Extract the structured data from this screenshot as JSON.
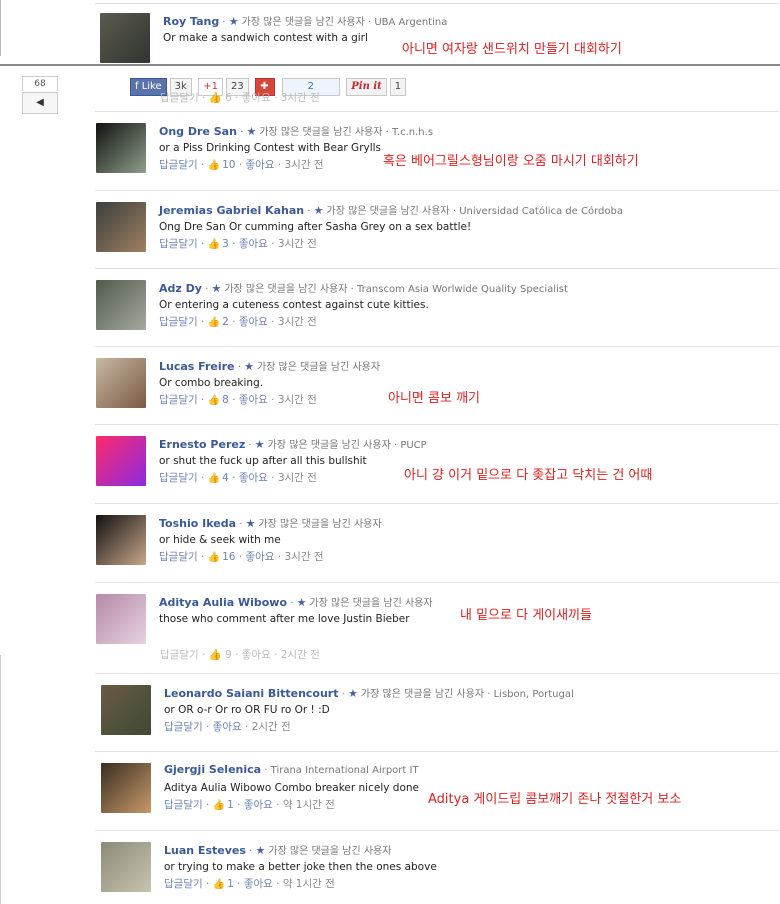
{
  "ui": {
    "like_glyph": "👍",
    "dot": " · ",
    "star": "★"
  },
  "share_bar": {
    "fb_like_label": "Like",
    "fb_like_count": "3k",
    "gplus_label": "+1",
    "gplus_count": "23",
    "counter_2": "2",
    "pin_label": "Pin it",
    "pin_count": "1",
    "side_count": "68",
    "side_back": "◀"
  },
  "comments_top": [
    {
      "name": "Roy Tang",
      "badge": "가장 많은 댓글을 남긴 사용자",
      "affiliation": "UBA Argentina",
      "text": "Or make a sandwich contest with a girl",
      "note": "아니면 여자랑 샌드위치 만들기 대회하기",
      "avatar_colors": [
        "#5d5a4e",
        "#2e3530"
      ]
    }
  ],
  "comments_mid": [
    {
      "name": "Ong Dre San",
      "badge": "가장 많은 댓글을 남긴 사용자",
      "affiliation": "T.c.n.h.s",
      "text": "or a Piss Drinking Contest with Bear Grylls",
      "reply": "답글달기",
      "likes": "10",
      "like_label": "좋아요",
      "time": "3시간 전",
      "note": "혹은 베어그릴스형님이랑 오줌 마시기 대회하기",
      "avatar_colors": [
        "#111111",
        "#8fa08a"
      ]
    },
    {
      "name": "Jeremias Gabriel Kahan",
      "badge": "가장 많은 댓글을 남긴 사용자",
      "affiliation": "Universidad Católica de Córdoba",
      "text": "Ong Dre San Or cumming after Sasha Grey on a sex battle!",
      "reply": "답글달기",
      "likes": "3",
      "like_label": "좋아요",
      "time": "3시간 전",
      "note": "",
      "avatar_colors": [
        "#3a3f3c",
        "#a08062"
      ]
    },
    {
      "name": "Adz Dy",
      "badge": "가장 많은 댓글을 남긴 사용자",
      "affiliation": "Transcom Asia Worlwide Quality Specialist",
      "text": "Or entering a cuteness contest against cute kitties.",
      "reply": "답글달기",
      "likes": "2",
      "like_label": "좋아요",
      "time": "3시간 전",
      "note": "",
      "avatar_colors": [
        "#505a48",
        "#a5a9a0"
      ]
    },
    {
      "name": "Lucas Freire",
      "badge": "가장 많은 댓글을 남긴 사용자",
      "affiliation": "",
      "text": "Or combo breaking.",
      "reply": "답글달기",
      "likes": "8",
      "like_label": "좋아요",
      "time": "3시간 전",
      "note": "아니면 콤보 깨기",
      "avatar_colors": [
        "#c8b8a2",
        "#7a5a45"
      ]
    },
    {
      "name": "Ernesto Perez",
      "badge": "가장 많은 댓글을 남긴 사용자",
      "affiliation": "PUCP",
      "text": "or shut the fuck up after all this bullshit",
      "reply": "답글달기",
      "likes": "4",
      "like_label": "좋아요",
      "time": "3시간 전",
      "note": "아니 걍 이거 밑으로 다 좆잡고 닥치는 건 어때",
      "avatar_colors": [
        "#ff2a6a",
        "#8a2be2"
      ]
    },
    {
      "name": "Toshio Ikeda",
      "badge": "가장 많은 댓글을 남긴 사용자",
      "affiliation": "",
      "text": "or hide & seek with me",
      "reply": "답글달기",
      "likes": "16",
      "like_label": "좋아요",
      "time": "3시간 전",
      "note": "",
      "avatar_colors": [
        "#121212",
        "#c9a68a"
      ]
    },
    {
      "name": "Aditya Aulia Wibowo",
      "badge": "가장 많은 댓글을 남긴 사용자",
      "affiliation": "",
      "text": "those who comment after me love Justin Bieber",
      "reply": "",
      "likes": "",
      "like_label": "",
      "time": "",
      "note": "내 밑으로 다 게이새끼들",
      "avatar_colors": [
        "#b68aa8",
        "#e6d2de"
      ]
    }
  ],
  "comments_bot": [
    {
      "name": "Leonardo Saiani Bittencourt",
      "badge": "가장 많은 댓글을 남긴 사용자",
      "affiliation": "Lisbon, Portugal",
      "text": "or OR o-r Or ro OR FU ro Or ! :D",
      "reply": "답글달기",
      "likes": "",
      "like_label": "좋아요",
      "time": "2시간 전",
      "note": "",
      "avatar_colors": [
        "#6b5a44",
        "#3d4a34"
      ]
    },
    {
      "name": "Gjergji Selenica",
      "badge": "",
      "affiliation": "Tirana International Airport IT",
      "text": "Aditya Aulia Wibowo Combo breaker nicely done",
      "reply": "답글달기",
      "likes": "1",
      "like_label": "좋아요",
      "time": "약 1시간 전",
      "note": "Aditya 게이드립 콤보깨기 존나 젓절한거 보소",
      "avatar_colors": [
        "#3a2e22",
        "#c89a6a"
      ]
    },
    {
      "name": "Luan Esteves",
      "badge": "가장 많은 댓글을 남긴 사용자",
      "affiliation": "",
      "text": "or trying to make a better joke then the ones above",
      "reply": "답글달기",
      "likes": "1",
      "like_label": "좋아요",
      "time": "약 1시간 전",
      "note": "",
      "avatar_colors": [
        "#8d8a76",
        "#c7c3b2"
      ]
    }
  ],
  "partial_rows": {
    "top_cut": "답글달기 · 👍 6 · 좋아요 · 3시간 전",
    "mid_cut": "답글달기 · 👍 9 · 좋아요 · 2시간 전"
  }
}
